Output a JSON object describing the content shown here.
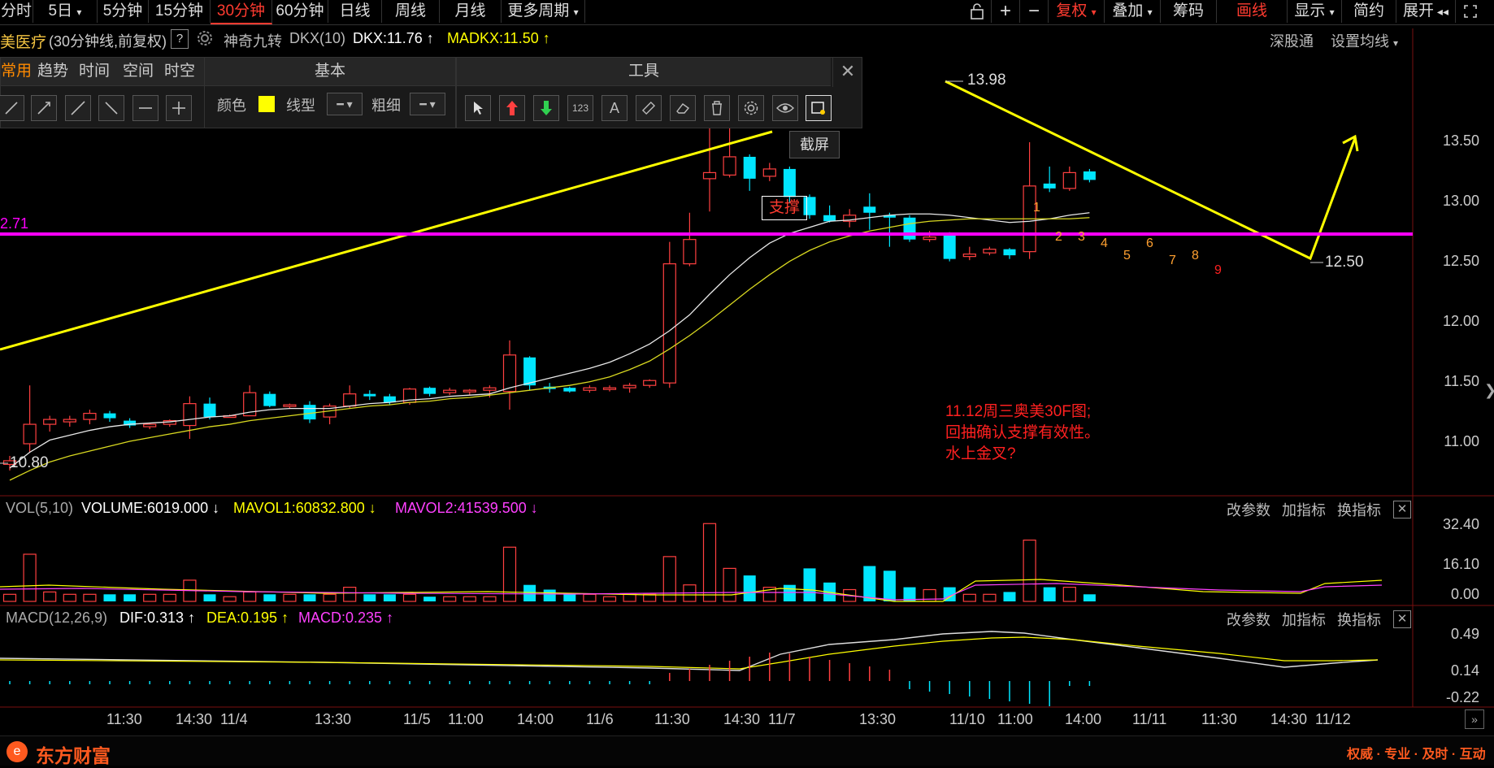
{
  "toolbar": {
    "periods": [
      "分时",
      "5日",
      "5分钟",
      "15分钟",
      "30分钟",
      "60分钟",
      "日线",
      "周线",
      "月线",
      "更多周期"
    ],
    "active_period": "30分钟",
    "right_items": {
      "fuquan": "复权",
      "diejia": "叠加",
      "chouma": "筹码",
      "huaxian": "画线",
      "xianshi": "显示",
      "jianyue": "简约",
      "zhankai": "展开"
    }
  },
  "title": {
    "stock": "美医疗",
    "period_note": "(30分钟线,前复权)",
    "help": "?",
    "indicator_name": "神奇九转",
    "dkx_label": "DKX(10)",
    "dkx_value": "DKX:11.76",
    "madkx_value": "MADKX:11.50",
    "shengu": "深股通",
    "set_ma": "设置均线"
  },
  "panels": {
    "left_tabs": [
      "常用",
      "趋势",
      "时间",
      "空间",
      "时空"
    ],
    "basic_title": "基本",
    "color_label": "颜色",
    "line_label": "线型",
    "width_label": "粗细",
    "tools_title": "工具",
    "tooltip": "截屏"
  },
  "annotations": {
    "support": "支撑",
    "note_line1": "11.12周三奥美30F图;",
    "note_line2": "回抽确认支撑有效性。",
    "note_line3": "水上金叉?",
    "high_label": "13.98",
    "low_label": "12.50",
    "left_low_label": "10.80",
    "hline_label": "2.71",
    "count_labels": [
      "1",
      "2",
      "3",
      "4",
      "5",
      "6",
      "7",
      "8",
      "9"
    ]
  },
  "price_axis": [
    "13.50",
    "13.00",
    "12.50",
    "12.00",
    "11.50",
    "11.00"
  ],
  "volume": {
    "title": "VOL(5,10)",
    "volume_value": "VOLUME:6019.000",
    "mavol1": "MAVOL1:60832.800",
    "mavol2": "MAVOL2:41539.500",
    "axis": [
      "32.40",
      "16.10",
      "0.00"
    ],
    "buttons": [
      "改参数",
      "加指标",
      "换指标"
    ]
  },
  "macd": {
    "title": "MACD(12,26,9)",
    "dif": "DIF:0.313",
    "dea": "DEA:0.195",
    "macd": "MACD:0.235",
    "axis": [
      "0.49",
      "0.14",
      "-0.22"
    ],
    "buttons": [
      "改参数",
      "加指标",
      "换指标"
    ]
  },
  "time_axis": [
    "11:30",
    "14:30",
    "11/4",
    "13:30",
    "11/5",
    "11:00",
    "14:00",
    "11/6",
    "11:30",
    "14:30",
    "11/7",
    "13:30",
    "11/10",
    "11:00",
    "14:00",
    "11/11",
    "11:30",
    "14:30",
    "11/12"
  ],
  "footer": {
    "brand": "东方财富",
    "slogan": "权威 · 专业 · 及时 · 互动"
  },
  "colors": {
    "up": "#ff4040",
    "down": "#00e5ff",
    "yellow_line": "#ffff00",
    "magenta_line": "#ff00ff",
    "active_red": "#ff3b30"
  },
  "chart_data": {
    "type": "candlestick",
    "price_range": [
      10.7,
      14.05
    ],
    "candles": [
      {
        "o": 10.85,
        "h": 10.92,
        "l": 10.8,
        "c": 10.88
      },
      {
        "o": 11.02,
        "h": 11.5,
        "l": 10.95,
        "c": 11.18
      },
      {
        "o": 11.18,
        "h": 11.25,
        "l": 11.12,
        "c": 11.22
      },
      {
        "o": 11.2,
        "h": 11.25,
        "l": 11.16,
        "c": 11.22
      },
      {
        "o": 11.22,
        "h": 11.3,
        "l": 11.18,
        "c": 11.27
      },
      {
        "o": 11.27,
        "h": 11.29,
        "l": 11.2,
        "c": 11.23
      },
      {
        "o": 11.21,
        "h": 11.23,
        "l": 11.15,
        "c": 11.17
      },
      {
        "o": 11.16,
        "h": 11.19,
        "l": 11.14,
        "c": 11.18
      },
      {
        "o": 11.18,
        "h": 11.22,
        "l": 11.16,
        "c": 11.21
      },
      {
        "o": 11.17,
        "h": 11.41,
        "l": 11.06,
        "c": 11.35
      },
      {
        "o": 11.35,
        "h": 11.4,
        "l": 11.22,
        "c": 11.24
      },
      {
        "o": 11.25,
        "h": 11.26,
        "l": 11.24,
        "c": 11.25
      },
      {
        "o": 11.25,
        "h": 11.5,
        "l": 11.25,
        "c": 11.44
      },
      {
        "o": 11.43,
        "h": 11.45,
        "l": 11.32,
        "c": 11.33
      },
      {
        "o": 11.33,
        "h": 11.35,
        "l": 11.31,
        "c": 11.34
      },
      {
        "o": 11.34,
        "h": 11.37,
        "l": 11.19,
        "c": 11.22
      },
      {
        "o": 11.24,
        "h": 11.35,
        "l": 11.18,
        "c": 11.33
      },
      {
        "o": 11.33,
        "h": 11.5,
        "l": 11.31,
        "c": 11.43
      },
      {
        "o": 11.43,
        "h": 11.46,
        "l": 11.38,
        "c": 11.41
      },
      {
        "o": 11.41,
        "h": 11.43,
        "l": 11.34,
        "c": 11.36
      },
      {
        "o": 11.36,
        "h": 11.48,
        "l": 11.34,
        "c": 11.47
      },
      {
        "o": 11.48,
        "h": 11.49,
        "l": 11.41,
        "c": 11.43
      },
      {
        "o": 11.44,
        "h": 11.48,
        "l": 11.42,
        "c": 11.46
      },
      {
        "o": 11.45,
        "h": 11.47,
        "l": 11.42,
        "c": 11.46
      },
      {
        "o": 11.46,
        "h": 11.5,
        "l": 11.4,
        "c": 11.48
      },
      {
        "o": 11.45,
        "h": 11.87,
        "l": 11.3,
        "c": 11.75
      },
      {
        "o": 11.73,
        "h": 11.74,
        "l": 11.46,
        "c": 11.5
      },
      {
        "o": 11.49,
        "h": 11.52,
        "l": 11.44,
        "c": 11.47
      },
      {
        "o": 11.48,
        "h": 11.49,
        "l": 11.44,
        "c": 11.45
      },
      {
        "o": 11.46,
        "h": 11.5,
        "l": 11.44,
        "c": 11.48
      },
      {
        "o": 11.47,
        "h": 11.5,
        "l": 11.45,
        "c": 11.48
      },
      {
        "o": 11.48,
        "h": 11.52,
        "l": 11.44,
        "c": 11.5
      },
      {
        "o": 11.5,
        "h": 11.55,
        "l": 11.48,
        "c": 11.54
      },
      {
        "o": 11.52,
        "h": 12.68,
        "l": 11.48,
        "c": 12.5
      },
      {
        "o": 12.5,
        "h": 12.92,
        "l": 12.48,
        "c": 12.7
      },
      {
        "o": 13.2,
        "h": 13.98,
        "l": 12.93,
        "c": 13.25
      },
      {
        "o": 13.23,
        "h": 13.8,
        "l": 13.21,
        "c": 13.38
      },
      {
        "o": 13.38,
        "h": 13.4,
        "l": 13.1,
        "c": 13.2
      },
      {
        "o": 13.22,
        "h": 13.33,
        "l": 13.18,
        "c": 13.28
      },
      {
        "o": 13.28,
        "h": 13.3,
        "l": 13.0,
        "c": 13.05
      },
      {
        "o": 13.05,
        "h": 13.07,
        "l": 12.87,
        "c": 12.9
      },
      {
        "o": 12.9,
        "h": 12.98,
        "l": 12.84,
        "c": 12.85
      },
      {
        "o": 12.85,
        "h": 12.95,
        "l": 12.8,
        "c": 12.9
      },
      {
        "o": 12.97,
        "h": 13.08,
        "l": 12.78,
        "c": 12.92
      },
      {
        "o": 12.9,
        "h": 12.92,
        "l": 12.64,
        "c": 12.88
      },
      {
        "o": 12.88,
        "h": 12.9,
        "l": 12.68,
        "c": 12.7
      },
      {
        "o": 12.7,
        "h": 12.77,
        "l": 12.68,
        "c": 12.72
      },
      {
        "o": 12.75,
        "h": 12.76,
        "l": 12.52,
        "c": 12.54
      },
      {
        "o": 12.56,
        "h": 12.64,
        "l": 12.53,
        "c": 12.58
      },
      {
        "o": 12.59,
        "h": 12.64,
        "l": 12.57,
        "c": 12.62
      },
      {
        "o": 12.62,
        "h": 12.63,
        "l": 12.54,
        "c": 12.57
      },
      {
        "o": 12.6,
        "h": 13.5,
        "l": 12.54,
        "c": 13.14
      },
      {
        "o": 13.16,
        "h": 13.3,
        "l": 13.09,
        "c": 13.12
      },
      {
        "o": 13.12,
        "h": 13.3,
        "l": 13.1,
        "c": 13.25
      },
      {
        "o": 13.26,
        "h": 13.28,
        "l": 13.17,
        "c": 13.19
      }
    ],
    "volume": [
      3,
      20,
      4,
      3,
      3,
      3,
      3,
      3,
      3,
      9,
      3,
      2,
      4,
      3,
      3,
      3,
      3,
      6,
      3,
      3,
      3,
      2,
      2,
      2,
      2,
      23,
      7,
      5,
      3,
      3,
      2,
      3,
      3,
      19,
      7,
      33,
      14,
      11,
      6,
      7,
      14,
      8,
      5,
      15,
      13,
      6,
      5,
      6,
      3,
      3,
      4,
      26,
      6,
      6,
      3
    ],
    "support_price": 12.71,
    "ma_white": [
      10.82,
      10.95,
      11.05,
      11.09,
      11.13,
      11.16,
      11.18,
      11.19,
      11.2,
      11.22,
      11.24,
      11.25,
      11.28,
      11.3,
      11.31,
      11.31,
      11.31,
      11.33,
      11.35,
      11.36,
      11.38,
      11.39,
      11.41,
      11.42,
      11.43,
      11.48,
      11.52,
      11.56,
      11.6,
      11.64,
      11.69,
      11.76,
      11.84,
      11.95,
      12.08,
      12.25,
      12.41,
      12.55,
      12.67,
      12.75,
      12.8,
      12.85,
      12.86,
      12.88,
      12.9,
      12.91,
      12.91,
      12.9,
      12.88,
      12.86,
      12.84,
      12.85,
      12.87,
      12.9,
      12.92
    ],
    "ma_yellow": [
      10.72,
      10.8,
      10.87,
      10.92,
      10.96,
      11.0,
      11.04,
      11.07,
      11.1,
      11.13,
      11.16,
      11.18,
      11.21,
      11.23,
      11.25,
      11.27,
      11.29,
      11.31,
      11.33,
      11.34,
      11.36,
      11.37,
      11.39,
      11.4,
      11.42,
      11.44,
      11.46,
      11.48,
      11.5,
      11.53,
      11.57,
      11.63,
      11.7,
      11.8,
      11.91,
      12.03,
      12.16,
      12.29,
      12.41,
      12.52,
      12.61,
      12.68,
      12.73,
      12.77,
      12.8,
      12.83,
      12.85,
      12.86,
      12.87,
      12.87,
      12.87,
      12.87,
      12.87,
      12.87,
      12.88
    ]
  }
}
